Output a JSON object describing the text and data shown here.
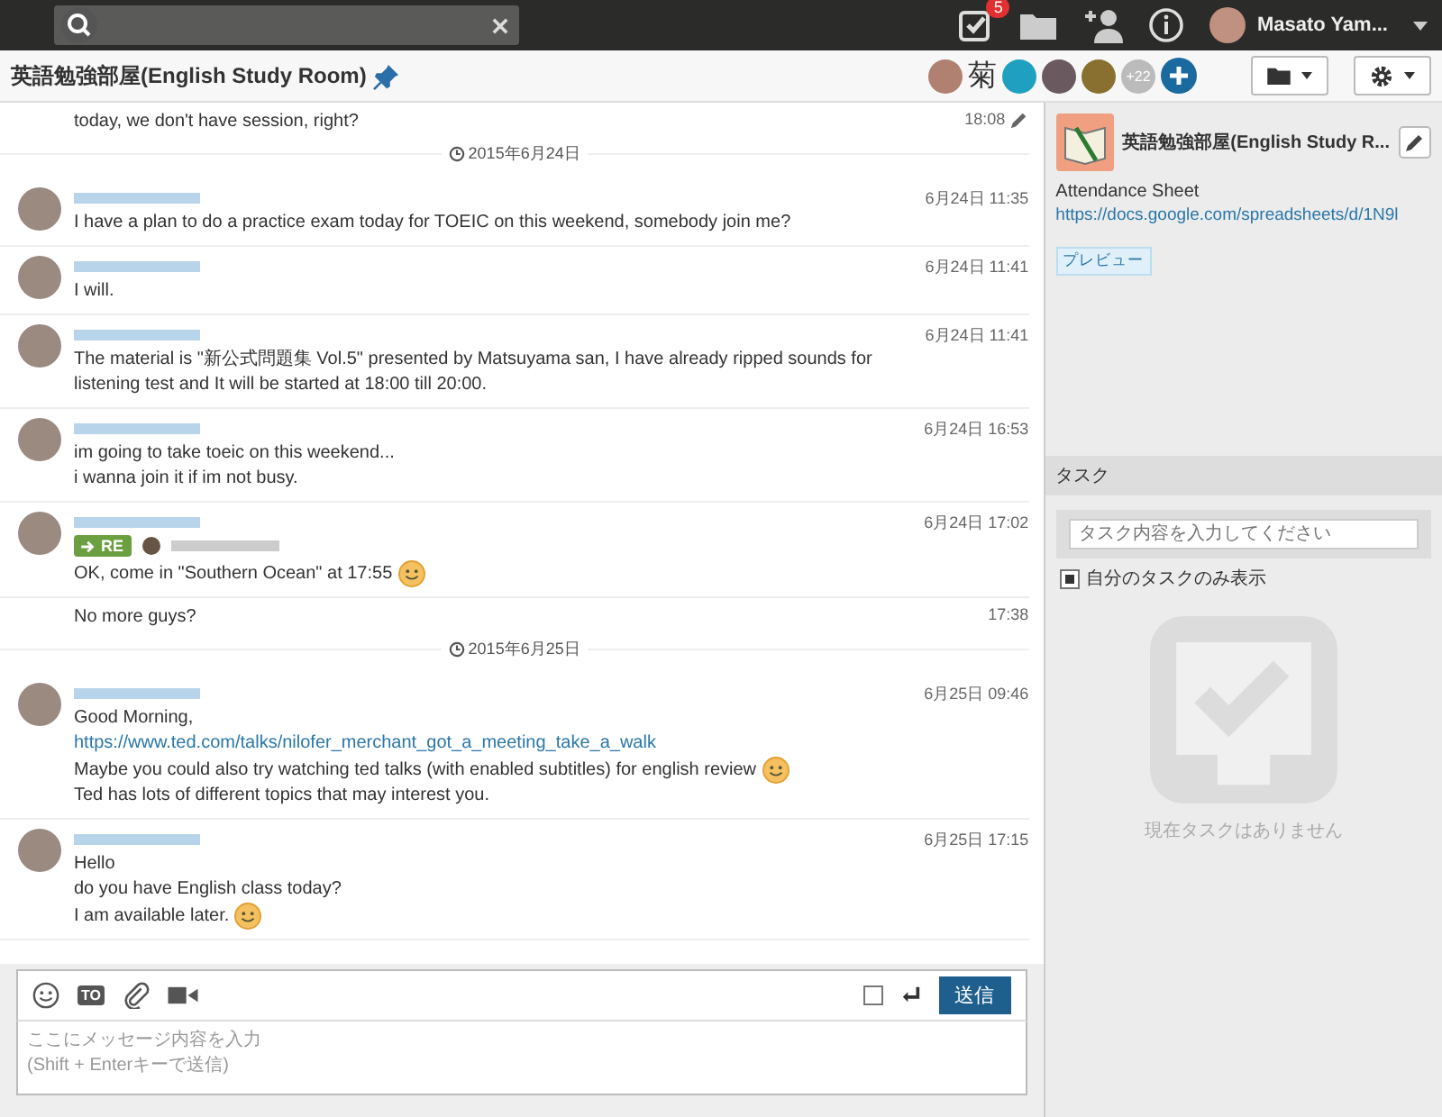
{
  "topbar": {
    "task_badge": "5",
    "user_name": "Masato Yam..."
  },
  "room_header": {
    "title": "英語勉強部屋(English Study Room)",
    "pinned": true,
    "member_glyph": "菊",
    "more_members": "+22"
  },
  "timeline": [
    {
      "kind": "continuation",
      "time": "18:08",
      "edited": true,
      "lines": [
        {
          "kind": "text",
          "text": "today, we don't have session, right?",
          "emoji": false
        }
      ]
    },
    {
      "kind": "date",
      "text": "2015年6月24日"
    },
    {
      "kind": "message",
      "time": "6月24日 11:35",
      "lines": [
        {
          "kind": "text",
          "text": "I have a plan to do a practice exam today for TOEIC on this weekend, somebody join me?",
          "emoji": false
        }
      ]
    },
    {
      "kind": "message",
      "time": "6月24日 11:41",
      "lines": [
        {
          "kind": "text",
          "text": "I will.",
          "emoji": false
        }
      ]
    },
    {
      "kind": "message",
      "time": "6月24日 11:41",
      "lines": [
        {
          "kind": "text",
          "text": "The material is \"新公式問題集 Vol.5\" presented by Matsuyama san, I have already ripped sounds for listening test and It will be started at 18:00 till 20:00.",
          "emoji": false
        }
      ]
    },
    {
      "kind": "message",
      "time": "6月24日 16:53",
      "lines": [
        {
          "kind": "text",
          "text": "im going to take toeic on this weekend...",
          "emoji": false
        },
        {
          "kind": "text",
          "text": "i wanna join it if im not busy.",
          "emoji": false
        }
      ]
    },
    {
      "kind": "message",
      "time": "6月24日 17:02",
      "reply": "RE",
      "lines": [
        {
          "kind": "text",
          "text": "OK, come in \"Southern Ocean\" at 17:55",
          "emoji": true
        }
      ]
    },
    {
      "kind": "continuation",
      "time": "17:38",
      "edited": false,
      "lines": [
        {
          "kind": "text",
          "text": "No more guys?",
          "emoji": false
        }
      ]
    },
    {
      "kind": "date",
      "text": "2015年6月25日"
    },
    {
      "kind": "message",
      "time": "6月25日 09:46",
      "lines": [
        {
          "kind": "text",
          "text": "Good Morning,",
          "emoji": false
        },
        {
          "kind": "link",
          "text": "https://www.ted.com/talks/nilofer_merchant_got_a_meeting_take_a_walk",
          "emoji": false
        },
        {
          "kind": "text",
          "text": "Maybe you could also try watching ted talks (with enabled subtitles) for english review",
          "emoji": true
        },
        {
          "kind": "text",
          "text": "Ted has lots of different topics that may interest you.",
          "emoji": false
        }
      ]
    },
    {
      "kind": "message",
      "time": "6月25日 17:15",
      "lines": [
        {
          "kind": "text",
          "text": "Hello",
          "emoji": false
        },
        {
          "kind": "text",
          "text": "do you have English class today?",
          "emoji": false
        },
        {
          "kind": "text",
          "text": "I am available later.",
          "emoji": true
        }
      ]
    }
  ],
  "composer": {
    "to_label": "TO",
    "enter_to_send": false,
    "send_button": "送信",
    "placeholder": "ここにメッセージ内容を入力\n(Shift + Enterキーで送信)"
  },
  "room_info": {
    "name": "英語勉強部屋(English Study R...",
    "description": "Attendance Sheet",
    "link": "https://docs.google.com/spreadsheets/d/1N9l",
    "preview_button": "プレビュー"
  },
  "tasks": {
    "header": "タスク",
    "placeholder": "タスク内容を入力してください",
    "only_mine_label": "自分のタスクのみ表示",
    "only_mine": true,
    "empty_text": "現在タスクはありません"
  }
}
